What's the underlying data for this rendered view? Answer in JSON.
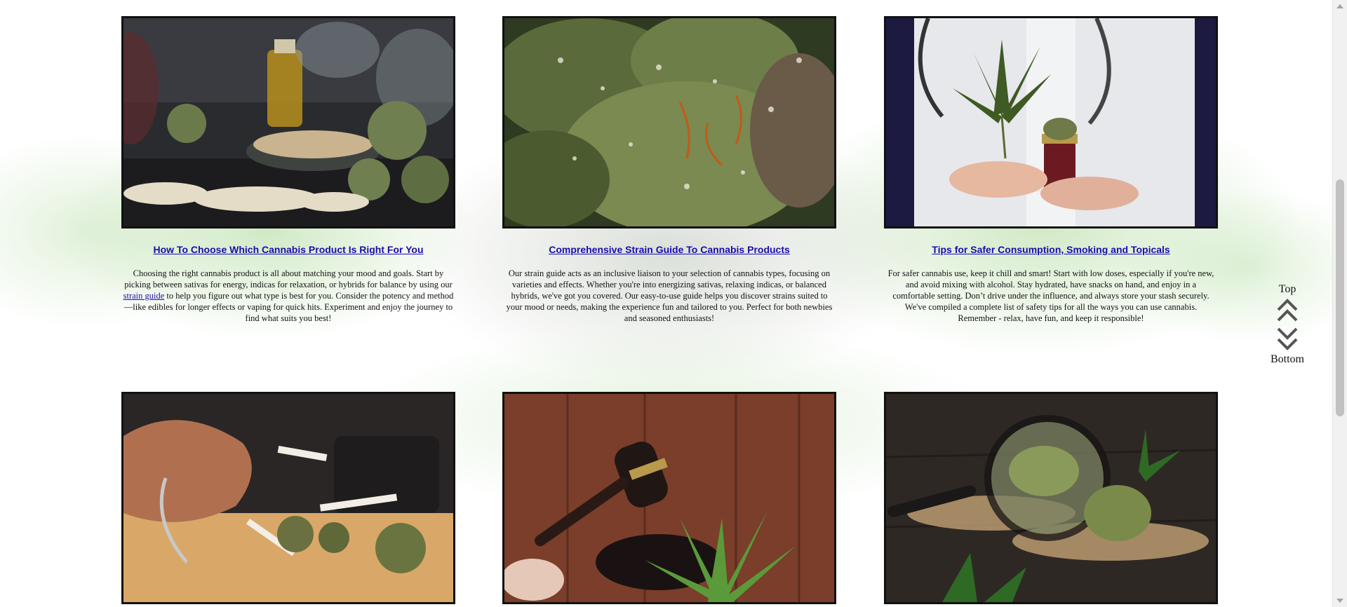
{
  "cards": [
    {
      "title": "How To Choose Which Cannabis Product Is Right For You",
      "desc_before": "Choosing the right cannabis product is all about matching your mood and goals. Start by picking between sativas for energy, indicas for relaxation, or hybrids for balance by using our ",
      "link_text": "strain guide",
      "desc_after": " to help you figure out what type is best for you. Consider the potency and method—like edibles for longer effects or vaping for quick hits. Experiment and enjoy the journey to find what suits you best!"
    },
    {
      "title": "Comprehensive Strain Guide To Cannabis Products",
      "desc": "Our strain guide acts as an inclusive liaison to your selection of cannabis types, focusing on varieties and effects. Whether you're into energizing sativas, relaxing indicas, or balanced hybrids, we've got you covered. Our easy-to-use guide helps you discover strains suited to your mood or needs, making the experience fun and tailored to you. Perfect for both newbies and seasoned enthusiasts!"
    },
    {
      "title": "Tips for Safer Consumption, Smoking and Topicals",
      "desc": "For safer cannabis use, keep it chill and smart! Start with low doses, especially if you're new, and avoid mixing with alcohol. Stay hydrated, have snacks on hand, and enjoy in a comfortable setting. Don’t drive under the influence, and always store your stash securely. We've compiled a complete list of safety tips for all the ways you can use cannabis. Remember - relax, have fun, and keep it responsible!"
    }
  ],
  "scroll_nav": {
    "top_label": "Top",
    "bottom_label": "Bottom"
  },
  "colors": {
    "link": "#1a0dab",
    "border": "#111111"
  }
}
